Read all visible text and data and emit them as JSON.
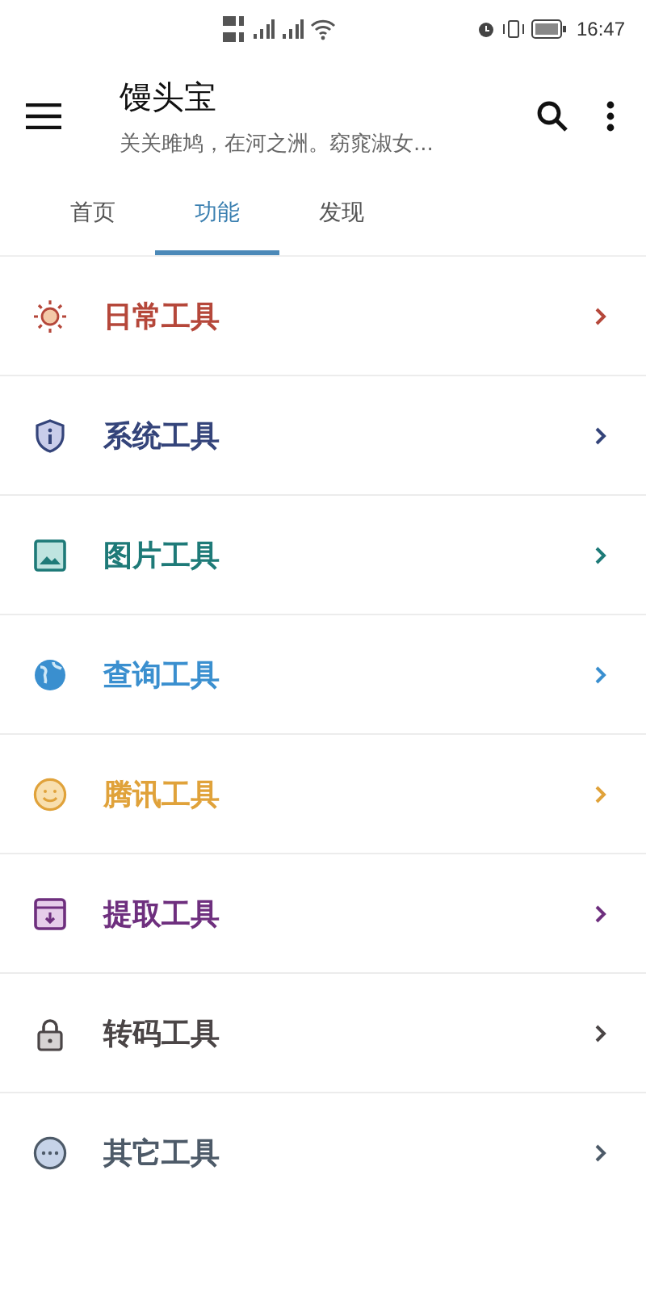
{
  "status_bar": {
    "time": "16:47"
  },
  "app_bar": {
    "title": "馒头宝",
    "subtitle": "关关雎鸠，在河之洲。窈窕淑女..."
  },
  "tabs": [
    {
      "label": "首页",
      "selected": false
    },
    {
      "label": "功能",
      "selected": true
    },
    {
      "label": "发现",
      "selected": false
    }
  ],
  "items": [
    {
      "label": "日常工具",
      "kind": "sun",
      "color": "#b5473a"
    },
    {
      "label": "系统工具",
      "kind": "shield",
      "color": "#34447a"
    },
    {
      "label": "图片工具",
      "kind": "image",
      "color": "#1e7a78"
    },
    {
      "label": "查询工具",
      "kind": "globe",
      "color": "#3a8fcf"
    },
    {
      "label": "腾讯工具",
      "kind": "smile",
      "color": "#e0a23a"
    },
    {
      "label": "提取工具",
      "kind": "box",
      "color": "#6e2f7e"
    },
    {
      "label": "转码工具",
      "kind": "lock",
      "color": "#4a4546"
    },
    {
      "label": "其它工具",
      "kind": "more",
      "color": "#4d5a68"
    }
  ]
}
